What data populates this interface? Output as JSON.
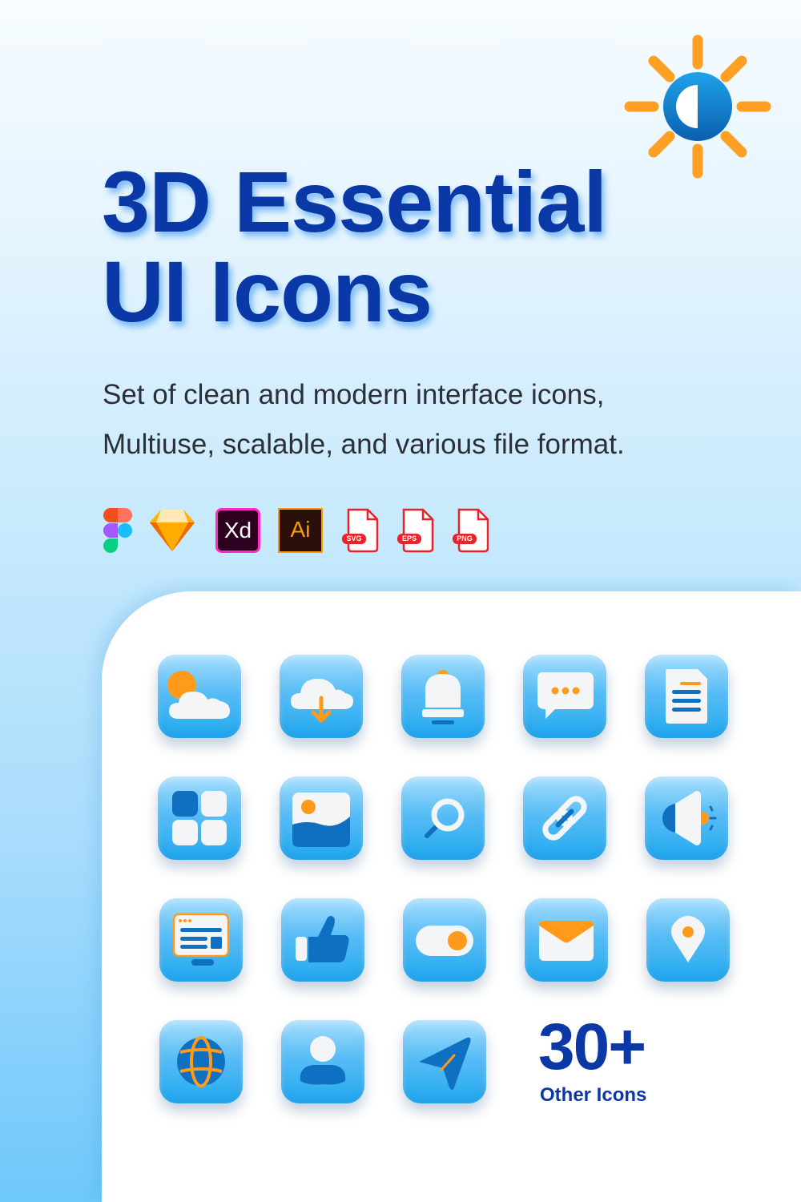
{
  "header": {
    "title_line1": "3D Essential",
    "title_line2": "UI Icons",
    "subtitle_line1": "Set of clean and modern interface icons,",
    "subtitle_line2": "Multiuse, scalable, and various file format.",
    "hero_icon": "brightness-sun-icon"
  },
  "formats": [
    {
      "name": "figma-icon",
      "label": ""
    },
    {
      "name": "sketch-icon",
      "label": ""
    },
    {
      "name": "adobe-xd-icon",
      "label": "Xd"
    },
    {
      "name": "adobe-illustrator-icon",
      "label": "Ai"
    },
    {
      "name": "svg-file-icon",
      "label": "SVG"
    },
    {
      "name": "eps-file-icon",
      "label": "EPS"
    },
    {
      "name": "png-file-icon",
      "label": "PNG"
    }
  ],
  "icon_grid": [
    [
      "weather-icon",
      "cloud-download-icon",
      "bell-icon",
      "chat-bubble-icon",
      "document-icon"
    ],
    [
      "apps-grid-icon",
      "image-icon",
      "search-icon",
      "link-icon",
      "speaker-icon"
    ],
    [
      "monitor-icon",
      "thumbs-up-icon",
      "toggle-switch-icon",
      "mail-icon",
      "location-pin-icon"
    ],
    [
      "globe-icon",
      "user-icon",
      "send-icon"
    ]
  ],
  "more": {
    "count": "30+",
    "label": "Other Icons"
  },
  "colors": {
    "title": "#0a38a6",
    "accent_orange": "#ff9d1c",
    "tile_blue": "#22a9ef",
    "deep_blue": "#0f6fc0"
  }
}
